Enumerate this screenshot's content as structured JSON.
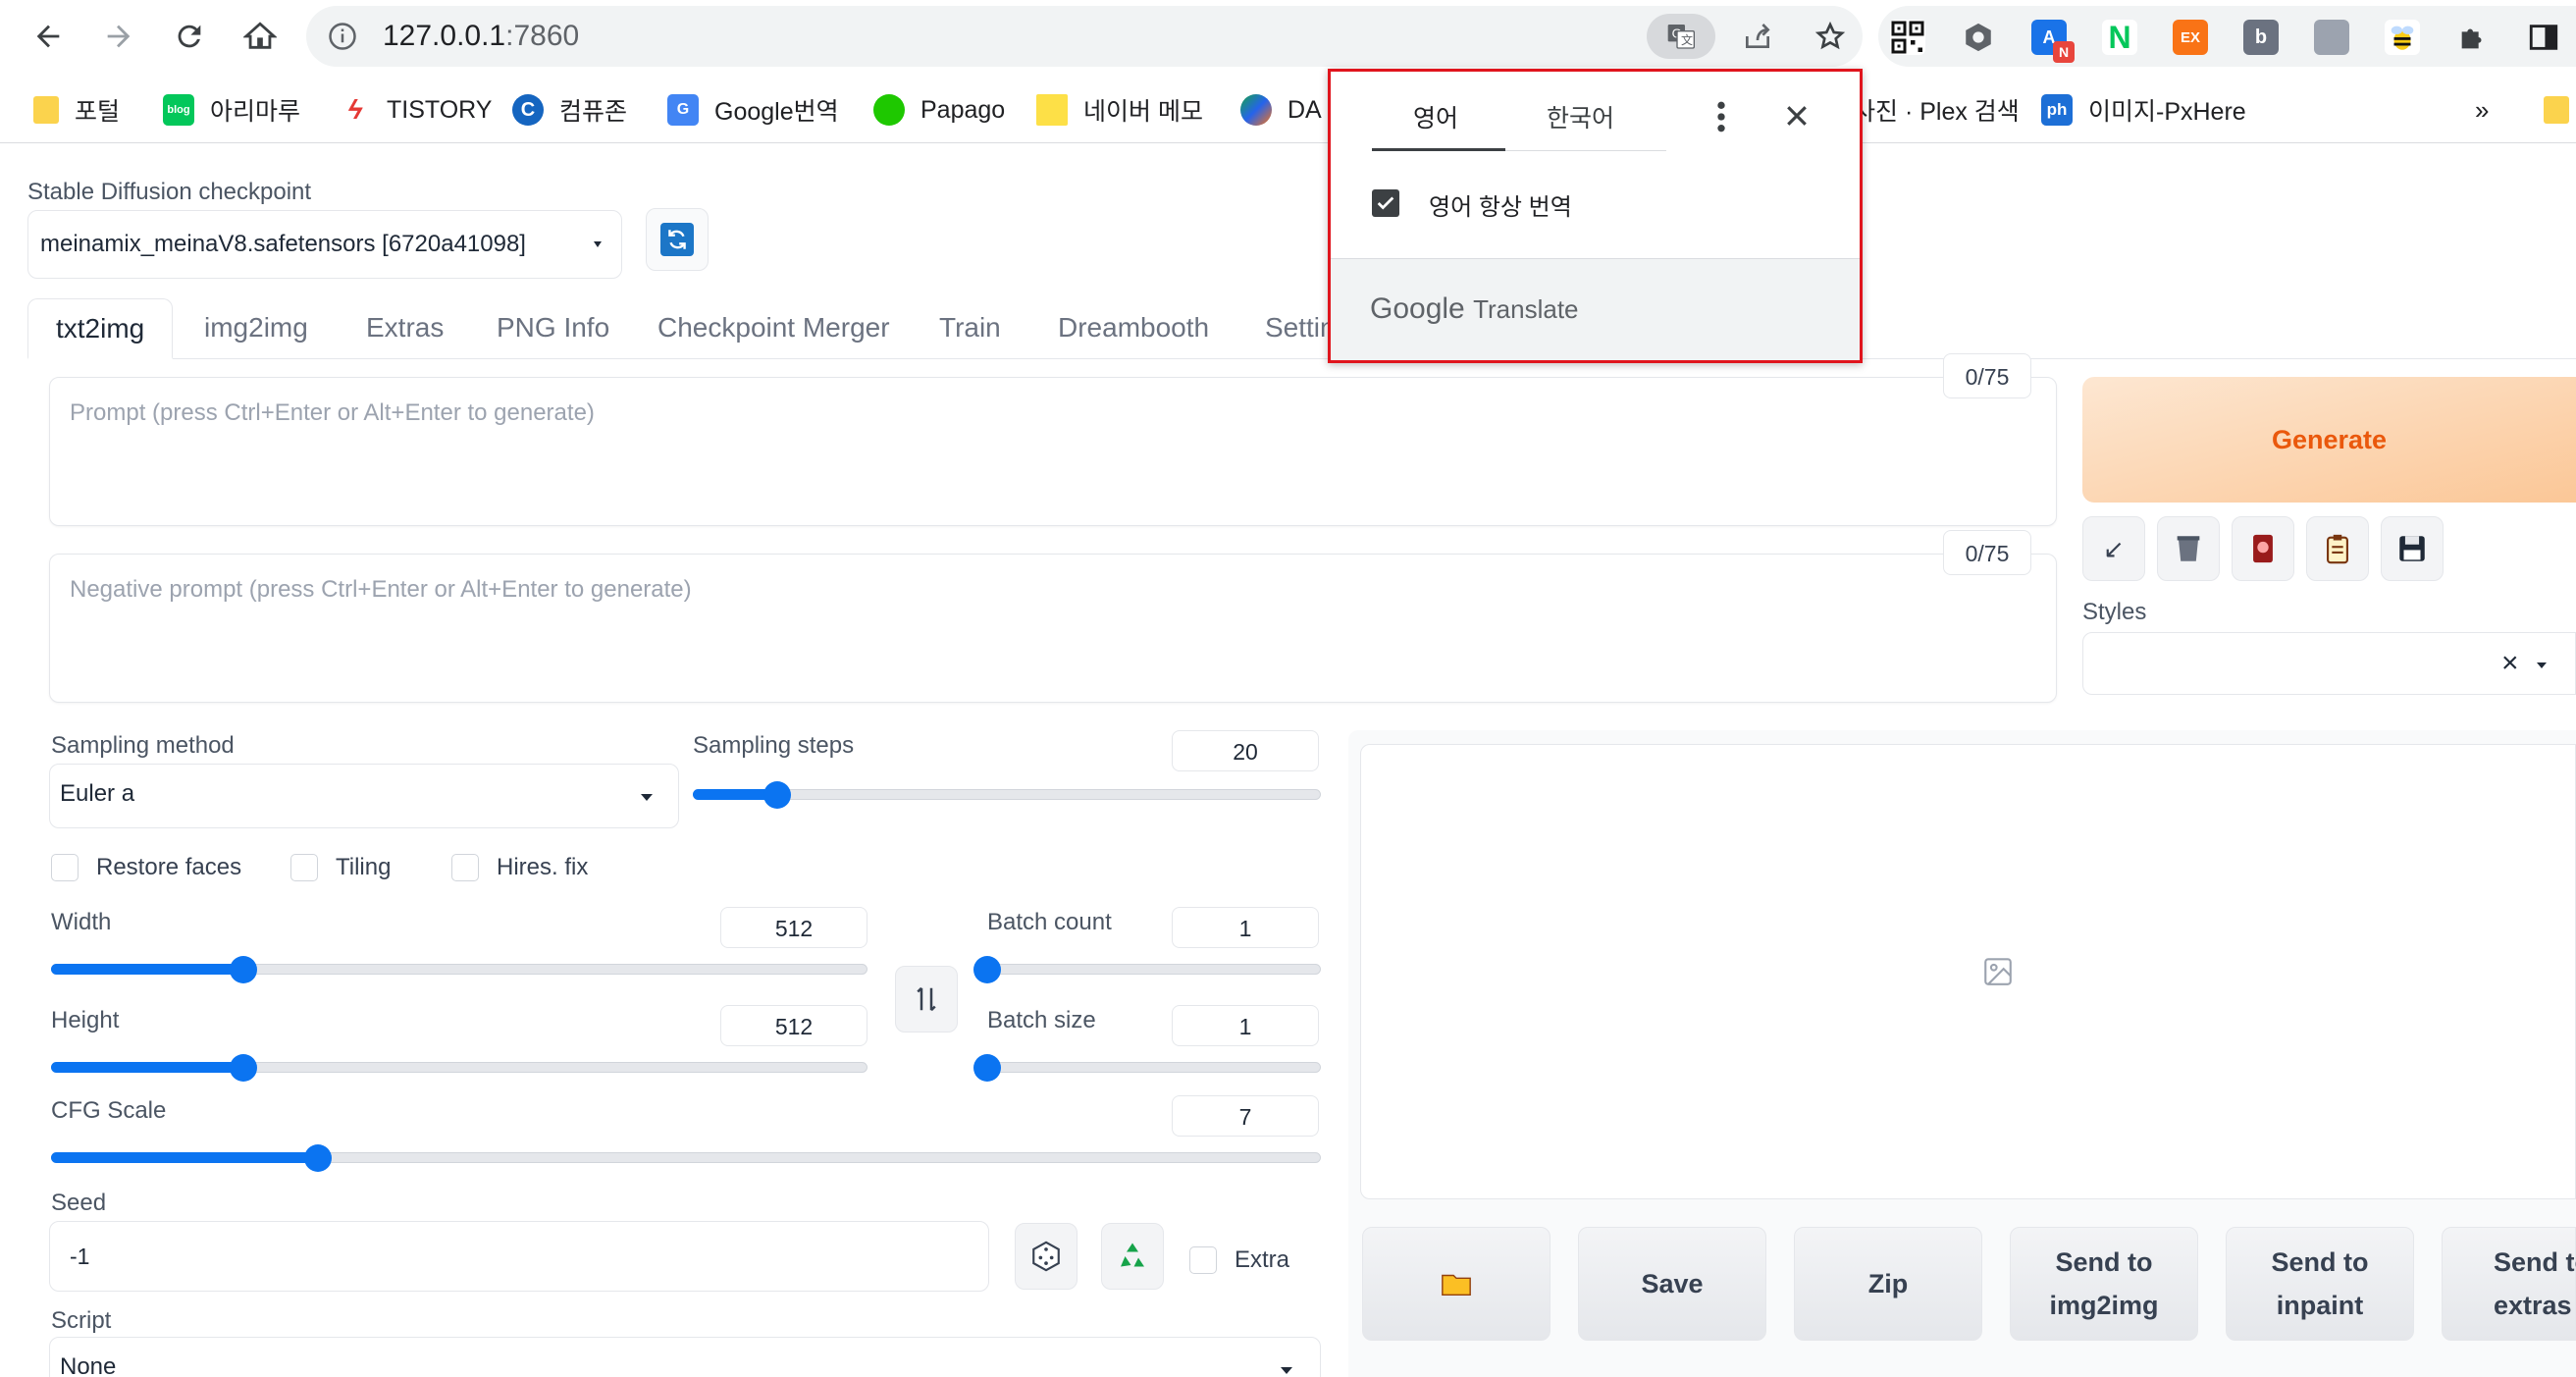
{
  "browser": {
    "url_host": "127.0.0.1",
    "url_port": ":7860",
    "extensions": [
      "qr-code-icon",
      "settings-ext-icon",
      "translate-ext-icon",
      "naver-ext-icon",
      "ex-ext-icon",
      "b-ext-icon",
      "wolf-ext-icon",
      "bee-ext-icon",
      "puzzle-icon",
      "sidebar-icon"
    ],
    "ex_badge": "EX",
    "b_badge": "b",
    "naver_badge": "N",
    "a_badge": "A"
  },
  "bookmarks": [
    {
      "label": "포털",
      "icon": "folder-icon"
    },
    {
      "label": "아리마루",
      "icon": "blog-icon",
      "badge": "blog"
    },
    {
      "label": "TISTORY",
      "icon": "tistory-icon"
    },
    {
      "label": "컴퓨존",
      "icon": "compuzone-icon",
      "badge": "C"
    },
    {
      "label": "Google번역",
      "icon": "google-translate-icon"
    },
    {
      "label": "Papago",
      "icon": "papago-icon"
    },
    {
      "label": "네이버 메모",
      "icon": "memo-icon"
    },
    {
      "label": "DA",
      "icon": "da-icon"
    },
    {
      "label": "사진 · Plex 검색",
      "icon": "plex-icon"
    },
    {
      "label": "이미지-PxHere",
      "icon": "pxhere-icon",
      "badge": "ph"
    }
  ],
  "bookmarks_more": "»",
  "translate_popup": {
    "tab_source": "영어",
    "tab_target": "한국어",
    "always_translate": "영어 항상 번역",
    "footer_google": "Google",
    "footer_translate": "Translate"
  },
  "checkpoint": {
    "label": "Stable Diffusion checkpoint",
    "value": "meinamix_meinaV8.safetensors [6720a41098]"
  },
  "tabs": [
    "txt2img",
    "img2img",
    "Extras",
    "PNG Info",
    "Checkpoint Merger",
    "Train",
    "Dreambooth",
    "Settin"
  ],
  "prompt": {
    "placeholder": "Prompt (press Ctrl+Enter or Alt+Enter to generate)",
    "counter": "0/75"
  },
  "negative_prompt": {
    "placeholder": "Negative prompt (press Ctrl+Enter or Alt+Enter to generate)",
    "counter": "0/75"
  },
  "generate_label": "Generate",
  "tool_buttons": [
    "↙",
    "trash-icon",
    "card-icon",
    "clipboard-icon",
    "save-icon"
  ],
  "styles_label": "Styles",
  "styles_clear": "×",
  "sampling_method": {
    "label": "Sampling method",
    "value": "Euler a"
  },
  "sampling_steps": {
    "label": "Sampling steps",
    "value": "20",
    "fraction": 0.135
  },
  "checkboxes": {
    "restore_faces": "Restore faces",
    "tiling": "Tiling",
    "hires_fix": "Hires. fix",
    "extra": "Extra"
  },
  "width": {
    "label": "Width",
    "value": "512",
    "fraction": 0.235
  },
  "height": {
    "label": "Height",
    "value": "512",
    "fraction": 0.235
  },
  "batch_count": {
    "label": "Batch count",
    "value": "1",
    "fraction": 0
  },
  "batch_size": {
    "label": "Batch size",
    "value": "1",
    "fraction": 0
  },
  "cfg_scale": {
    "label": "CFG Scale",
    "value": "7",
    "fraction": 0.21
  },
  "seed": {
    "label": "Seed",
    "value": "-1"
  },
  "script": {
    "label": "Script",
    "value": "None"
  },
  "action_buttons": {
    "folder": "folder-icon",
    "save": "Save",
    "zip": "Zip",
    "send_img2img_1": "Send to",
    "send_img2img_2": "img2img",
    "send_inpaint_1": "Send to",
    "send_inpaint_2": "inpaint",
    "send_extras_1": "Send to",
    "send_extras_2": "extras"
  },
  "colors": {
    "accent": "#0b74f1",
    "generate_text": "#ea580c",
    "popup_border": "#e0151d"
  }
}
